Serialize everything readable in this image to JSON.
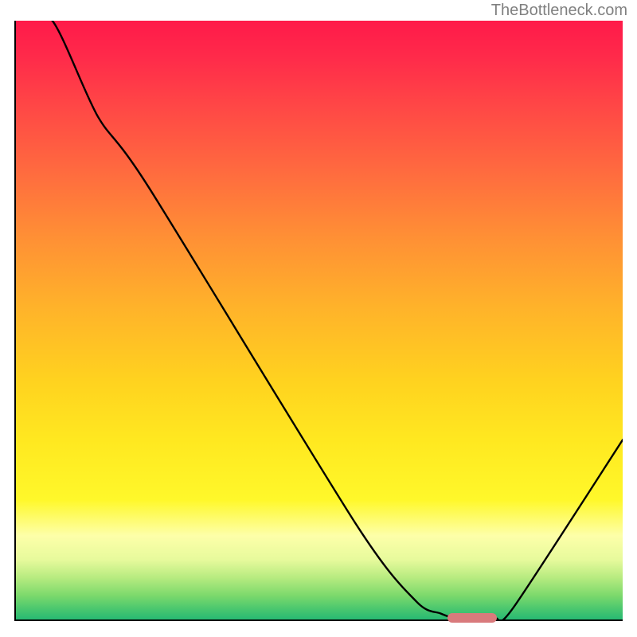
{
  "watermark": "TheBottleneck.com",
  "chart_data": {
    "type": "line",
    "title": "",
    "xlabel": "",
    "ylabel": "",
    "xlim": [
      0,
      100
    ],
    "ylim": [
      0,
      100
    ],
    "series": [
      {
        "name": "curve",
        "x": [
          0,
          6,
          13.5,
          22,
          56,
          66,
          70,
          73,
          76,
          79,
          82,
          100
        ],
        "values": [
          101,
          100,
          84,
          72,
          16,
          3,
          1,
          0,
          0,
          0.2,
          2,
          30
        ]
      }
    ],
    "marker": {
      "x_start": 71,
      "x_end": 79,
      "y": 0.5
    },
    "colors": {
      "curve": "#000000",
      "marker": "#d97a7c",
      "axis": "#000000"
    }
  }
}
